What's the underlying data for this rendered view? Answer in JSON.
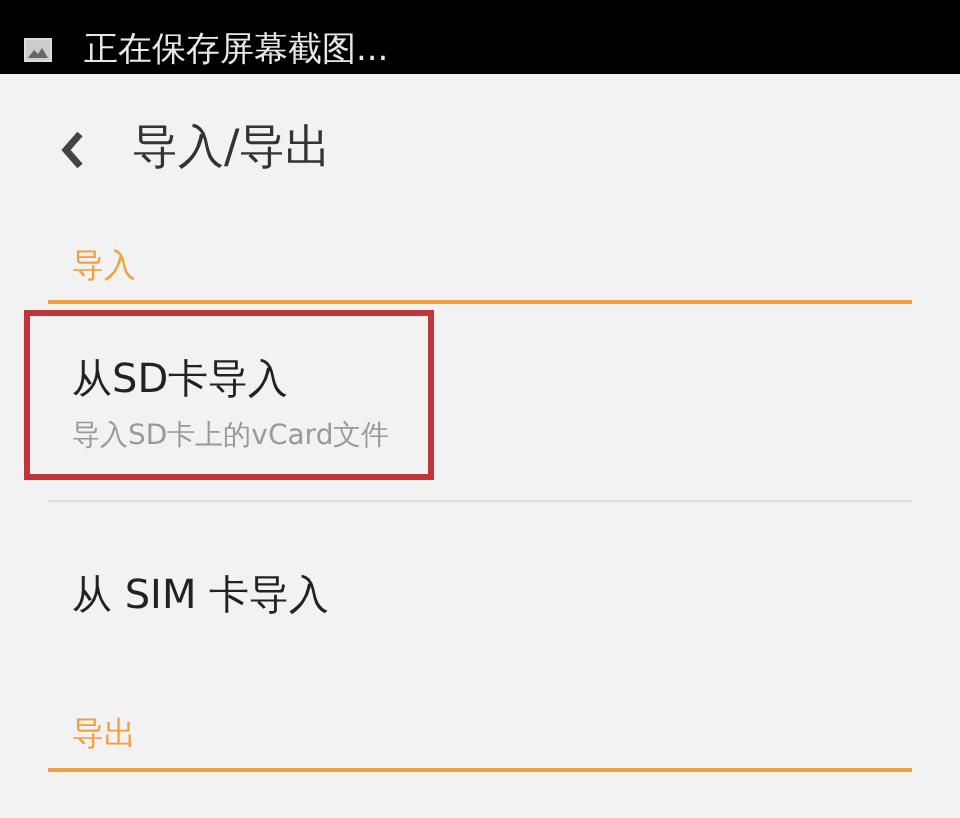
{
  "status_bar": {
    "notification": "正在保存屏幕截图..."
  },
  "header": {
    "title": "导入/导出"
  },
  "sections": [
    {
      "title": "导入",
      "items": [
        {
          "title": "从SD卡导入",
          "subtitle": "导入SD卡上的vCard文件",
          "highlighted": true
        },
        {
          "title": "从 SIM 卡导入",
          "highlighted": false
        }
      ]
    },
    {
      "title": "导出"
    }
  ]
}
